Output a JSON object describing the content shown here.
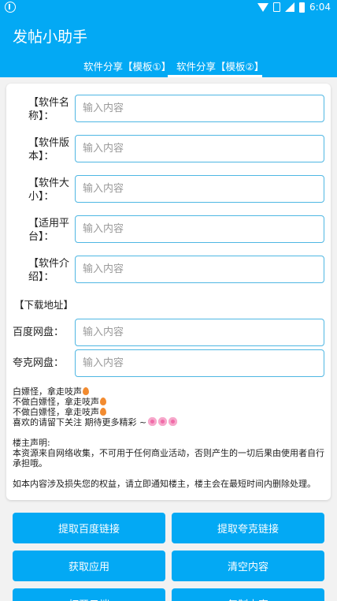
{
  "status_bar": {
    "time": "6:04"
  },
  "app": {
    "title": "发帖小助手"
  },
  "tabs": [
    {
      "label": "软件分享【模板①】"
    },
    {
      "label": "软件分享【模板②】",
      "selected": true
    }
  ],
  "fields": [
    {
      "label_line1": "【软件名",
      "label_line2": "称】：",
      "placeholder": "输入内容"
    },
    {
      "label_line1": "【软件版",
      "label_line2": "本】：",
      "placeholder": "输入内容"
    },
    {
      "label_line1": "【软件大",
      "label_line2": "小】：",
      "placeholder": "输入内容"
    },
    {
      "label_line1": "【适用平",
      "label_line2": "台】：",
      "placeholder": "输入内容"
    },
    {
      "label_line1": "【软件介",
      "label_line2": "绍】：",
      "placeholder": "输入内容"
    }
  ],
  "download": {
    "title": "【下载地址】",
    "baidu_label": "百度网盘：",
    "baidu_placeholder": "输入内容",
    "quark_label": "夸克网盘：",
    "quark_placeholder": "输入内容"
  },
  "notes": {
    "line1": "白嫖怪，拿走吱声",
    "line2": "不做白嫖怪，拿走吱声",
    "line3": "不做白嫖怪，拿走吱声",
    "line4": "喜欢的请留下关注 期待更多精彩 ~",
    "disclaimer_title": "楼主声明:",
    "disclaimer_body": "本资源来自网络收集，不可用于任何商业活动，否则产生的一切后果由使用者自行承担哦。",
    "disclaimer_footer": "如本内容涉及损失您的权益，请立即通知楼主，楼主会在最短时间内删除处理。"
  },
  "buttons": {
    "extract_baidu": "提取百度链接",
    "extract_quark": "提取夸克链接",
    "get_app": "获取应用",
    "clear": "清空内容",
    "bottom_left": "打开云端",
    "bottom_right": "复制内容"
  },
  "colors": {
    "accent": "#03a9f4",
    "input_border": "#4fb7e3",
    "background": "#f2f2f2"
  }
}
